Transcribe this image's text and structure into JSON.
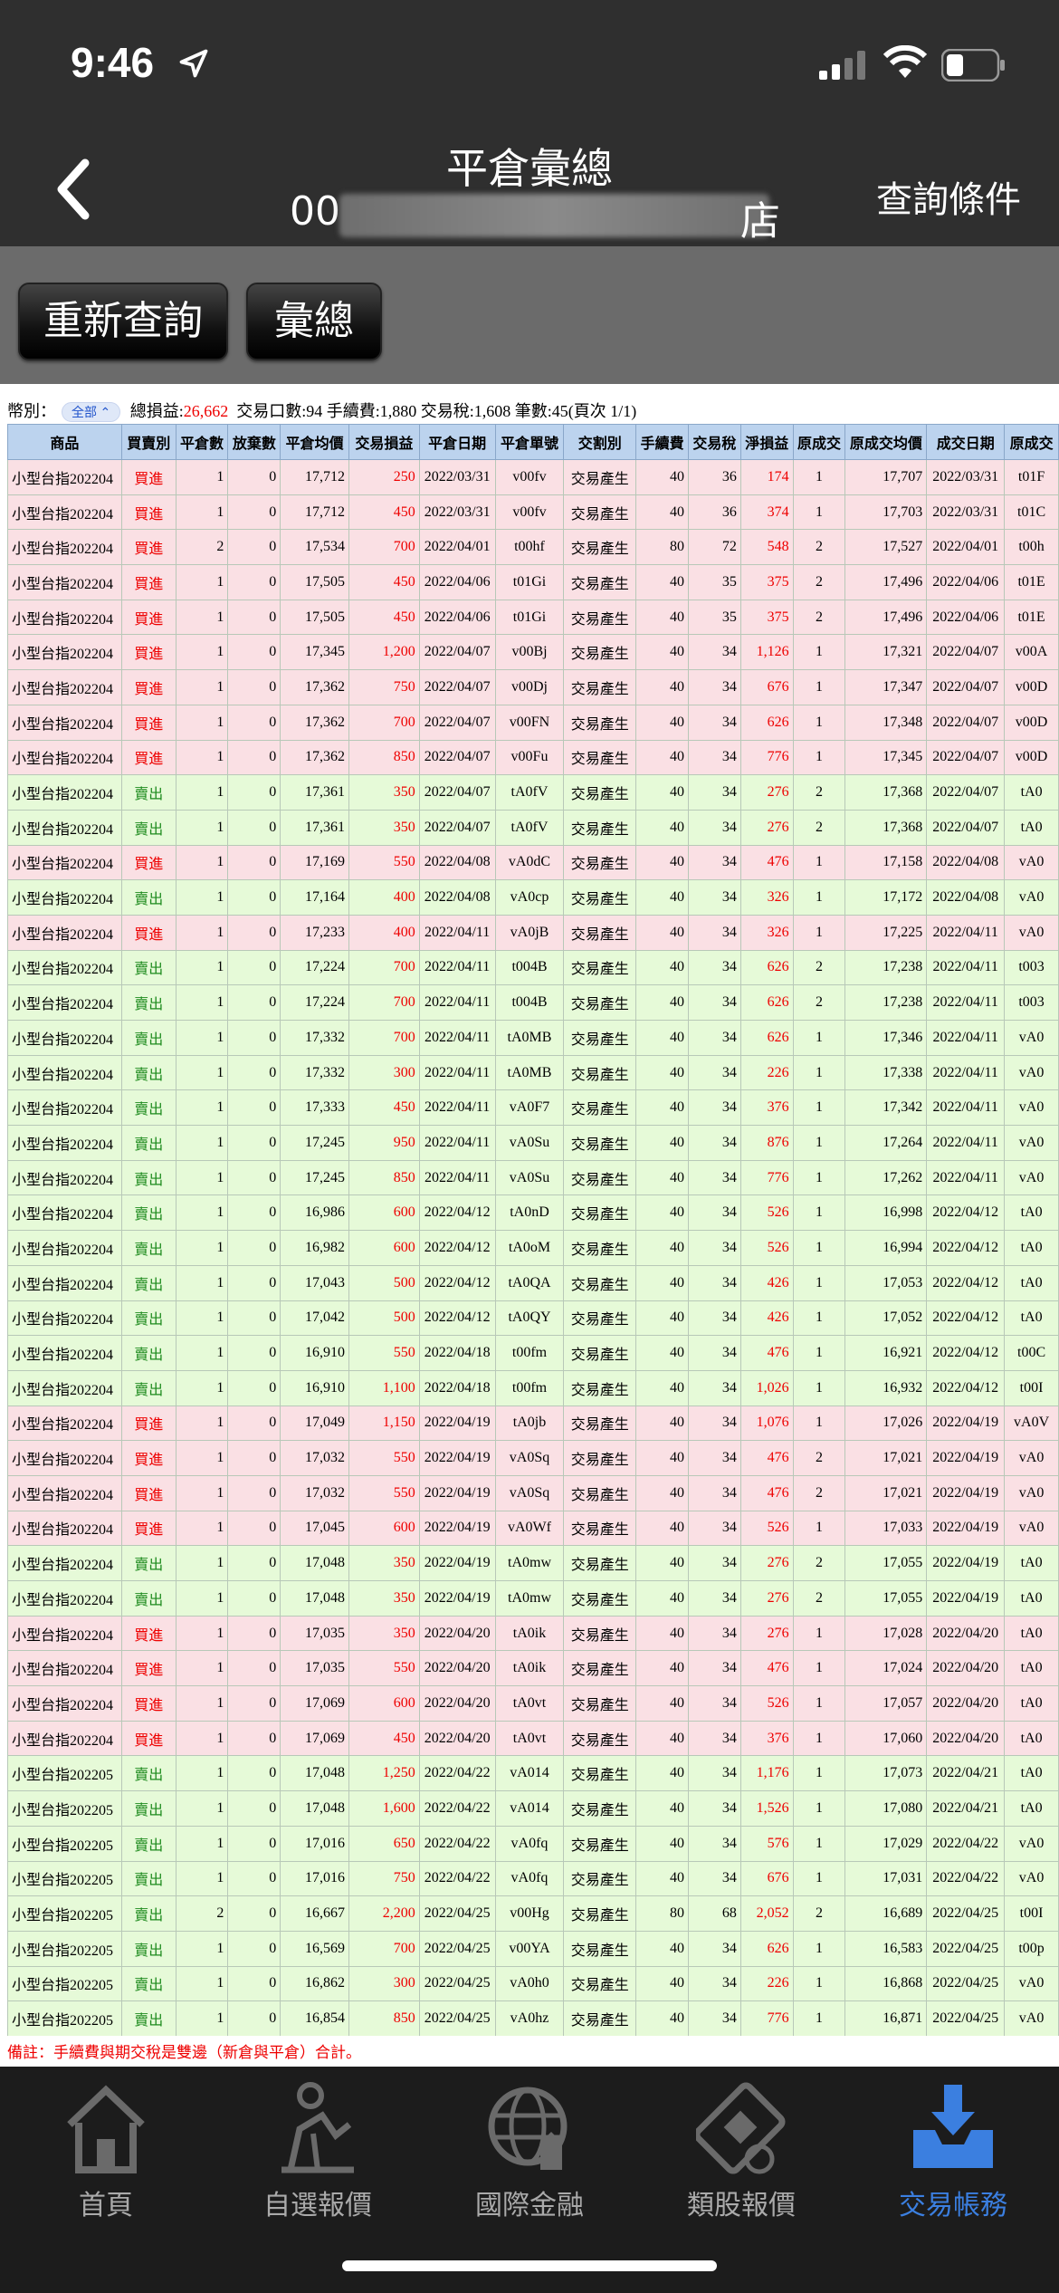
{
  "status": {
    "time": "9:46"
  },
  "nav": {
    "title": "平倉彙總",
    "subtitle_prefix": "00",
    "subtitle_suffix": "店",
    "right": "查詢條件"
  },
  "actions": {
    "requery": "重新查詢",
    "summary": "彙總"
  },
  "summary": {
    "category_label": "幣別：",
    "category_value": "全部",
    "total_pl_label": "總損益:",
    "total_pl": "26,662",
    "rest": "交易口數:94 手續費:1,880 交易稅:1,608 筆數:45(頁次 1/1)"
  },
  "table": {
    "headers": [
      "商品",
      "買賣別",
      "平倉數",
      "放棄數",
      "平倉均價",
      "交易損益",
      "平倉日期",
      "平倉單號",
      "交割別",
      "手續費",
      "交易稅",
      "淨損益",
      "原成交",
      "原成交均價",
      "成交日期",
      "原成交"
    ],
    "rows": [
      [
        "小型台指202204",
        "買進",
        "1",
        "0",
        "17,712",
        "250",
        "2022/03/31",
        "v00fv",
        "交易產生",
        "40",
        "36",
        "174",
        "1",
        "17,707",
        "2022/03/31",
        "t01F"
      ],
      [
        "小型台指202204",
        "買進",
        "1",
        "0",
        "17,712",
        "450",
        "2022/03/31",
        "v00fv",
        "交易產生",
        "40",
        "36",
        "374",
        "1",
        "17,703",
        "2022/03/31",
        "t01C"
      ],
      [
        "小型台指202204",
        "買進",
        "2",
        "0",
        "17,534",
        "700",
        "2022/04/01",
        "t00hf",
        "交易產生",
        "80",
        "72",
        "548",
        "2",
        "17,527",
        "2022/04/01",
        "t00h"
      ],
      [
        "小型台指202204",
        "買進",
        "1",
        "0",
        "17,505",
        "450",
        "2022/04/06",
        "t01Gi",
        "交易產生",
        "40",
        "35",
        "375",
        "2",
        "17,496",
        "2022/04/06",
        "t01E"
      ],
      [
        "小型台指202204",
        "買進",
        "1",
        "0",
        "17,505",
        "450",
        "2022/04/06",
        "t01Gi",
        "交易產生",
        "40",
        "35",
        "375",
        "2",
        "17,496",
        "2022/04/06",
        "t01E"
      ],
      [
        "小型台指202204",
        "買進",
        "1",
        "0",
        "17,345",
        "1,200",
        "2022/04/07",
        "v00Bj",
        "交易產生",
        "40",
        "34",
        "1,126",
        "1",
        "17,321",
        "2022/04/07",
        "v00A"
      ],
      [
        "小型台指202204",
        "買進",
        "1",
        "0",
        "17,362",
        "750",
        "2022/04/07",
        "v00Dj",
        "交易產生",
        "40",
        "34",
        "676",
        "1",
        "17,347",
        "2022/04/07",
        "v00D"
      ],
      [
        "小型台指202204",
        "買進",
        "1",
        "0",
        "17,362",
        "700",
        "2022/04/07",
        "v00FN",
        "交易產生",
        "40",
        "34",
        "626",
        "1",
        "17,348",
        "2022/04/07",
        "v00D"
      ],
      [
        "小型台指202204",
        "買進",
        "1",
        "0",
        "17,362",
        "850",
        "2022/04/07",
        "v00Fu",
        "交易產生",
        "40",
        "34",
        "776",
        "1",
        "17,345",
        "2022/04/07",
        "v00D"
      ],
      [
        "小型台指202204",
        "賣出",
        "1",
        "0",
        "17,361",
        "350",
        "2022/04/07",
        "tA0fV",
        "交易產生",
        "40",
        "34",
        "276",
        "2",
        "17,368",
        "2022/04/07",
        "tA0"
      ],
      [
        "小型台指202204",
        "賣出",
        "1",
        "0",
        "17,361",
        "350",
        "2022/04/07",
        "tA0fV",
        "交易產生",
        "40",
        "34",
        "276",
        "2",
        "17,368",
        "2022/04/07",
        "tA0"
      ],
      [
        "小型台指202204",
        "買進",
        "1",
        "0",
        "17,169",
        "550",
        "2022/04/08",
        "vA0dC",
        "交易產生",
        "40",
        "34",
        "476",
        "1",
        "17,158",
        "2022/04/08",
        "vA0"
      ],
      [
        "小型台指202204",
        "賣出",
        "1",
        "0",
        "17,164",
        "400",
        "2022/04/08",
        "vA0cp",
        "交易產生",
        "40",
        "34",
        "326",
        "1",
        "17,172",
        "2022/04/08",
        "vA0"
      ],
      [
        "小型台指202204",
        "買進",
        "1",
        "0",
        "17,233",
        "400",
        "2022/04/11",
        "vA0jB",
        "交易產生",
        "40",
        "34",
        "326",
        "1",
        "17,225",
        "2022/04/11",
        "vA0"
      ],
      [
        "小型台指202204",
        "賣出",
        "1",
        "0",
        "17,224",
        "700",
        "2022/04/11",
        "t004B",
        "交易產生",
        "40",
        "34",
        "626",
        "2",
        "17,238",
        "2022/04/11",
        "t003"
      ],
      [
        "小型台指202204",
        "賣出",
        "1",
        "0",
        "17,224",
        "700",
        "2022/04/11",
        "t004B",
        "交易產生",
        "40",
        "34",
        "626",
        "2",
        "17,238",
        "2022/04/11",
        "t003"
      ],
      [
        "小型台指202204",
        "賣出",
        "1",
        "0",
        "17,332",
        "700",
        "2022/04/11",
        "tA0MB",
        "交易產生",
        "40",
        "34",
        "626",
        "1",
        "17,346",
        "2022/04/11",
        "vA0"
      ],
      [
        "小型台指202204",
        "賣出",
        "1",
        "0",
        "17,332",
        "300",
        "2022/04/11",
        "tA0MB",
        "交易產生",
        "40",
        "34",
        "226",
        "1",
        "17,338",
        "2022/04/11",
        "vA0"
      ],
      [
        "小型台指202204",
        "賣出",
        "1",
        "0",
        "17,333",
        "450",
        "2022/04/11",
        "vA0F7",
        "交易產生",
        "40",
        "34",
        "376",
        "1",
        "17,342",
        "2022/04/11",
        "vA0"
      ],
      [
        "小型台指202204",
        "賣出",
        "1",
        "0",
        "17,245",
        "950",
        "2022/04/11",
        "vA0Su",
        "交易產生",
        "40",
        "34",
        "876",
        "1",
        "17,264",
        "2022/04/11",
        "vA0"
      ],
      [
        "小型台指202204",
        "賣出",
        "1",
        "0",
        "17,245",
        "850",
        "2022/04/11",
        "vA0Su",
        "交易產生",
        "40",
        "34",
        "776",
        "1",
        "17,262",
        "2022/04/11",
        "vA0"
      ],
      [
        "小型台指202204",
        "賣出",
        "1",
        "0",
        "16,986",
        "600",
        "2022/04/12",
        "tA0nD",
        "交易產生",
        "40",
        "34",
        "526",
        "1",
        "16,998",
        "2022/04/12",
        "tA0"
      ],
      [
        "小型台指202204",
        "賣出",
        "1",
        "0",
        "16,982",
        "600",
        "2022/04/12",
        "tA0oM",
        "交易產生",
        "40",
        "34",
        "526",
        "1",
        "16,994",
        "2022/04/12",
        "tA0"
      ],
      [
        "小型台指202204",
        "賣出",
        "1",
        "0",
        "17,043",
        "500",
        "2022/04/12",
        "tA0QA",
        "交易產生",
        "40",
        "34",
        "426",
        "1",
        "17,053",
        "2022/04/12",
        "tA0"
      ],
      [
        "小型台指202204",
        "賣出",
        "1",
        "0",
        "17,042",
        "500",
        "2022/04/12",
        "tA0QY",
        "交易產生",
        "40",
        "34",
        "426",
        "1",
        "17,052",
        "2022/04/12",
        "tA0"
      ],
      [
        "小型台指202204",
        "賣出",
        "1",
        "0",
        "16,910",
        "550",
        "2022/04/18",
        "t00fm",
        "交易產生",
        "40",
        "34",
        "476",
        "1",
        "16,921",
        "2022/04/12",
        "t00C"
      ],
      [
        "小型台指202204",
        "賣出",
        "1",
        "0",
        "16,910",
        "1,100",
        "2022/04/18",
        "t00fm",
        "交易產生",
        "40",
        "34",
        "1,026",
        "1",
        "16,932",
        "2022/04/12",
        "t00I"
      ],
      [
        "小型台指202204",
        "買進",
        "1",
        "0",
        "17,049",
        "1,150",
        "2022/04/19",
        "tA0jb",
        "交易產生",
        "40",
        "34",
        "1,076",
        "1",
        "17,026",
        "2022/04/19",
        "vA0V"
      ],
      [
        "小型台指202204",
        "買進",
        "1",
        "0",
        "17,032",
        "550",
        "2022/04/19",
        "vA0Sq",
        "交易產生",
        "40",
        "34",
        "476",
        "2",
        "17,021",
        "2022/04/19",
        "vA0"
      ],
      [
        "小型台指202204",
        "買進",
        "1",
        "0",
        "17,032",
        "550",
        "2022/04/19",
        "vA0Sq",
        "交易產生",
        "40",
        "34",
        "476",
        "2",
        "17,021",
        "2022/04/19",
        "vA0"
      ],
      [
        "小型台指202204",
        "買進",
        "1",
        "0",
        "17,045",
        "600",
        "2022/04/19",
        "vA0Wf",
        "交易產生",
        "40",
        "34",
        "526",
        "1",
        "17,033",
        "2022/04/19",
        "vA0"
      ],
      [
        "小型台指202204",
        "賣出",
        "1",
        "0",
        "17,048",
        "350",
        "2022/04/19",
        "tA0mw",
        "交易產生",
        "40",
        "34",
        "276",
        "2",
        "17,055",
        "2022/04/19",
        "tA0"
      ],
      [
        "小型台指202204",
        "賣出",
        "1",
        "0",
        "17,048",
        "350",
        "2022/04/19",
        "tA0mw",
        "交易產生",
        "40",
        "34",
        "276",
        "2",
        "17,055",
        "2022/04/19",
        "tA0"
      ],
      [
        "小型台指202204",
        "買進",
        "1",
        "0",
        "17,035",
        "350",
        "2022/04/20",
        "tA0ik",
        "交易產生",
        "40",
        "34",
        "276",
        "1",
        "17,028",
        "2022/04/20",
        "tA0"
      ],
      [
        "小型台指202204",
        "買進",
        "1",
        "0",
        "17,035",
        "550",
        "2022/04/20",
        "tA0ik",
        "交易產生",
        "40",
        "34",
        "476",
        "1",
        "17,024",
        "2022/04/20",
        "tA0"
      ],
      [
        "小型台指202204",
        "買進",
        "1",
        "0",
        "17,069",
        "600",
        "2022/04/20",
        "tA0vt",
        "交易產生",
        "40",
        "34",
        "526",
        "1",
        "17,057",
        "2022/04/20",
        "tA0"
      ],
      [
        "小型台指202204",
        "買進",
        "1",
        "0",
        "17,069",
        "450",
        "2022/04/20",
        "tA0vt",
        "交易產生",
        "40",
        "34",
        "376",
        "1",
        "17,060",
        "2022/04/20",
        "tA0"
      ],
      [
        "小型台指202205",
        "賣出",
        "1",
        "0",
        "17,048",
        "1,250",
        "2022/04/22",
        "vA014",
        "交易產生",
        "40",
        "34",
        "1,176",
        "1",
        "17,073",
        "2022/04/21",
        "tA0"
      ],
      [
        "小型台指202205",
        "賣出",
        "1",
        "0",
        "17,048",
        "1,600",
        "2022/04/22",
        "vA014",
        "交易產生",
        "40",
        "34",
        "1,526",
        "1",
        "17,080",
        "2022/04/21",
        "tA0"
      ],
      [
        "小型台指202205",
        "賣出",
        "1",
        "0",
        "17,016",
        "650",
        "2022/04/22",
        "vA0fq",
        "交易產生",
        "40",
        "34",
        "576",
        "1",
        "17,029",
        "2022/04/22",
        "vA0"
      ],
      [
        "小型台指202205",
        "賣出",
        "1",
        "0",
        "17,016",
        "750",
        "2022/04/22",
        "vA0fq",
        "交易產生",
        "40",
        "34",
        "676",
        "1",
        "17,031",
        "2022/04/22",
        "vA0"
      ],
      [
        "小型台指202205",
        "賣出",
        "2",
        "0",
        "16,667",
        "2,200",
        "2022/04/25",
        "v00Hg",
        "交易產生",
        "80",
        "68",
        "2,052",
        "2",
        "16,689",
        "2022/04/25",
        "t00I"
      ],
      [
        "小型台指202205",
        "賣出",
        "1",
        "0",
        "16,569",
        "700",
        "2022/04/25",
        "v00YA",
        "交易產生",
        "40",
        "34",
        "626",
        "1",
        "16,583",
        "2022/04/25",
        "t00p"
      ],
      [
        "小型台指202205",
        "賣出",
        "1",
        "0",
        "16,862",
        "300",
        "2022/04/25",
        "vA0h0",
        "交易產生",
        "40",
        "34",
        "226",
        "1",
        "16,868",
        "2022/04/25",
        "vA0"
      ],
      [
        "小型台指202205",
        "賣出",
        "1",
        "0",
        "16,854",
        "850",
        "2022/04/25",
        "vA0hz",
        "交易產生",
        "40",
        "34",
        "776",
        "1",
        "16,871",
        "2022/04/25",
        "vA0"
      ]
    ]
  },
  "note": "備註：手續費與期交稅是雙邊（新倉與平倉）合計。",
  "tabbar": {
    "items": [
      {
        "label": "首頁",
        "icon": "home-icon",
        "active": false
      },
      {
        "label": "自選報價",
        "icon": "person-chart-icon",
        "active": false
      },
      {
        "label": "國際金融",
        "icon": "globe-icon",
        "active": false
      },
      {
        "label": "類股報價",
        "icon": "film-coin-icon",
        "active": false
      },
      {
        "label": "交易帳務",
        "icon": "inbox-download-icon",
        "active": true
      }
    ]
  },
  "colors": {
    "buy_row": "#fae0e4",
    "sell_row": "#e6fad8",
    "header": "#bcd3ee",
    "profit": "#ee0000",
    "active_tab": "#3b7fe0"
  }
}
